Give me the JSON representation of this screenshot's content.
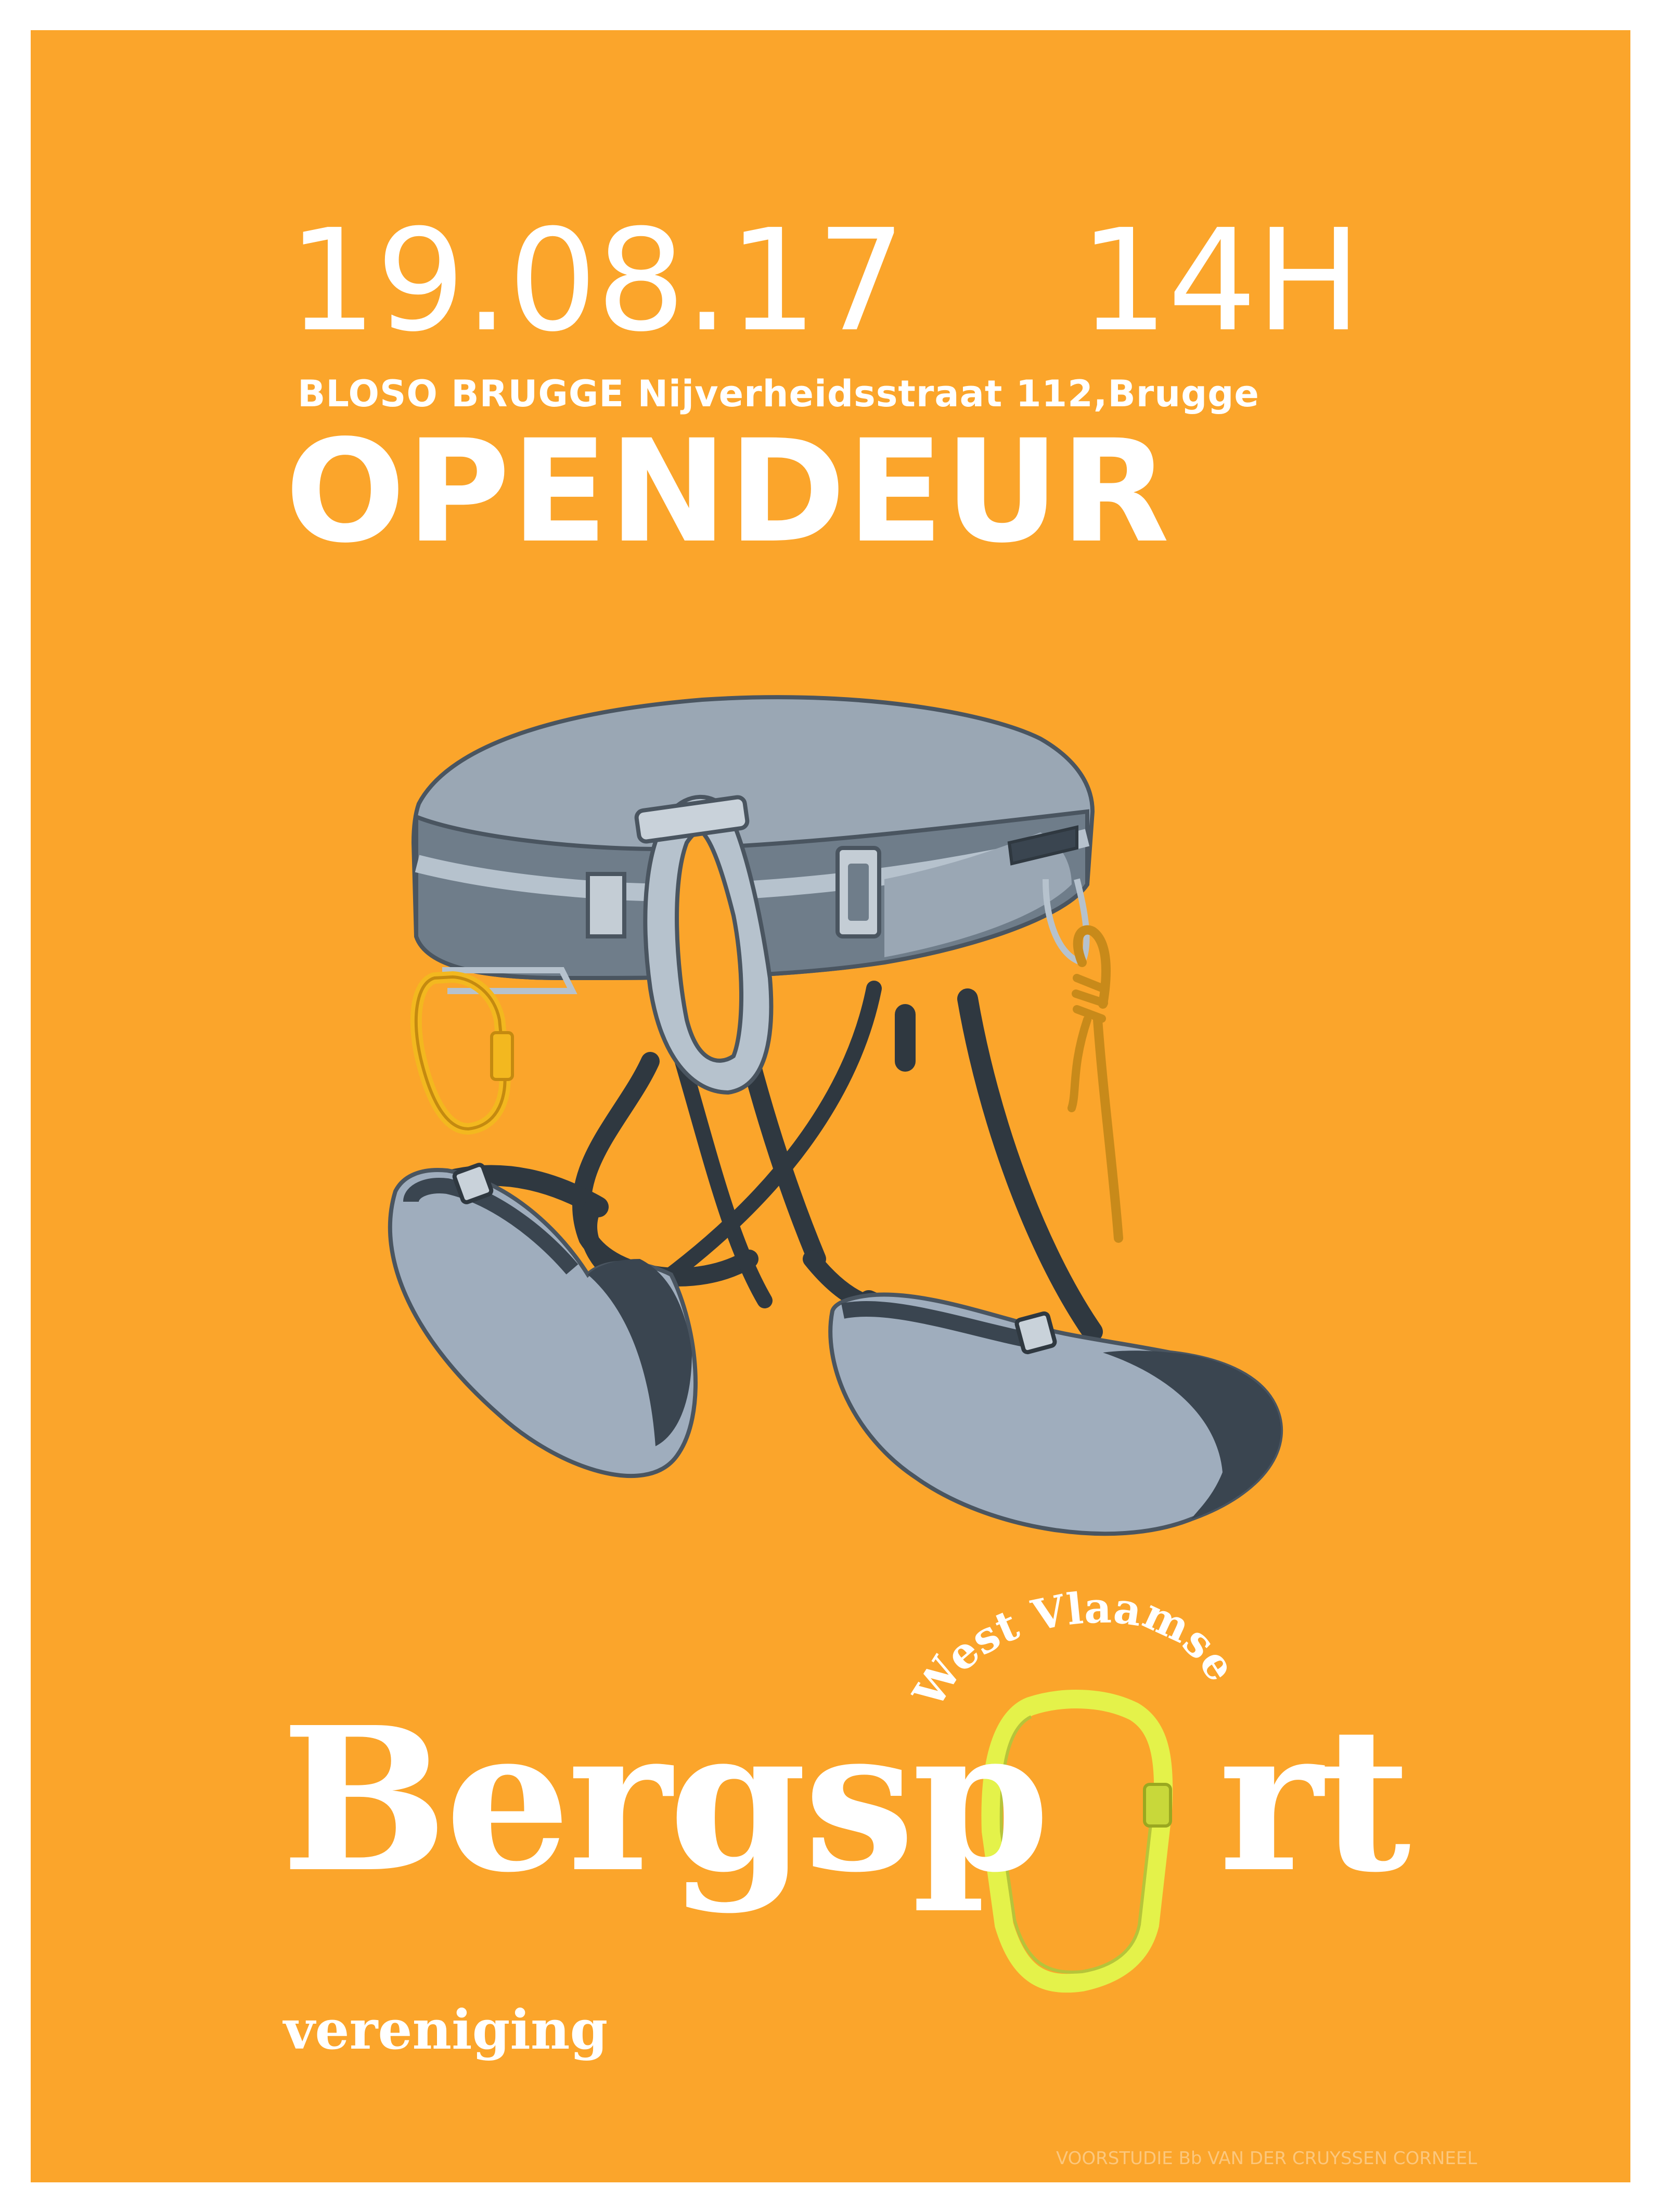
{
  "poster": {
    "date": "19.08.17",
    "time": "14H",
    "address": "BLOSO BRUGGE Nijverheidsstraat 112,Brugge",
    "title": "OPENDEUR",
    "credit": "VOORSTUDIE Bb VAN DER CRUYSSEN CORNEEL"
  },
  "logo": {
    "arc_text": "West Vlaamse",
    "word_left": "Bergsp",
    "word_right": "rt",
    "subtitle": "vereniging"
  },
  "colors": {
    "background": "#fba52b",
    "text": "#ffffff",
    "harness_light": "#a6b3c1",
    "harness_dark": "#3e4a55",
    "carabiner_yellow": "#f3b81f",
    "logo_carabiner": "#e4f24a"
  },
  "icons": {
    "harness": "climbing-harness-illustration",
    "carabiner": "carabiner-icon"
  }
}
